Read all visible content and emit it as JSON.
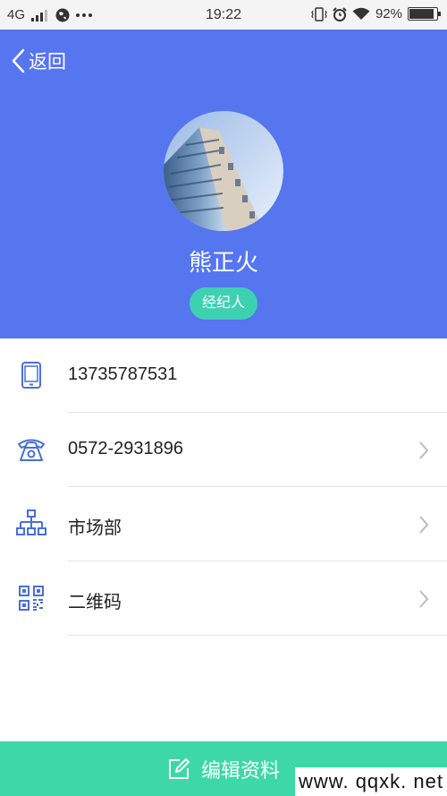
{
  "status_bar": {
    "network": "4G",
    "time": "19:22",
    "battery": "92%",
    "battery_level": 0.92
  },
  "header": {
    "back_label": "返回",
    "name": "熊正火",
    "role_badge": "经纪人"
  },
  "info_rows": [
    {
      "icon": "mobile-phone-icon",
      "text": "13735787531",
      "has_arrow": false
    },
    {
      "icon": "telephone-icon",
      "text": "0572-2931896",
      "has_arrow": true
    },
    {
      "icon": "org-chart-icon",
      "text": "市场部",
      "has_arrow": true
    },
    {
      "icon": "qr-code-icon",
      "text": "二维码",
      "has_arrow": true
    }
  ],
  "footer": {
    "edit_label": "编辑资料",
    "watermark": "www. qqxk. net"
  },
  "colors": {
    "header_bg": "#5576ee",
    "badge_bg": "#3dd1b2",
    "button_bg": "#3dd8a5",
    "icon_blue": "#4a6fd6"
  }
}
